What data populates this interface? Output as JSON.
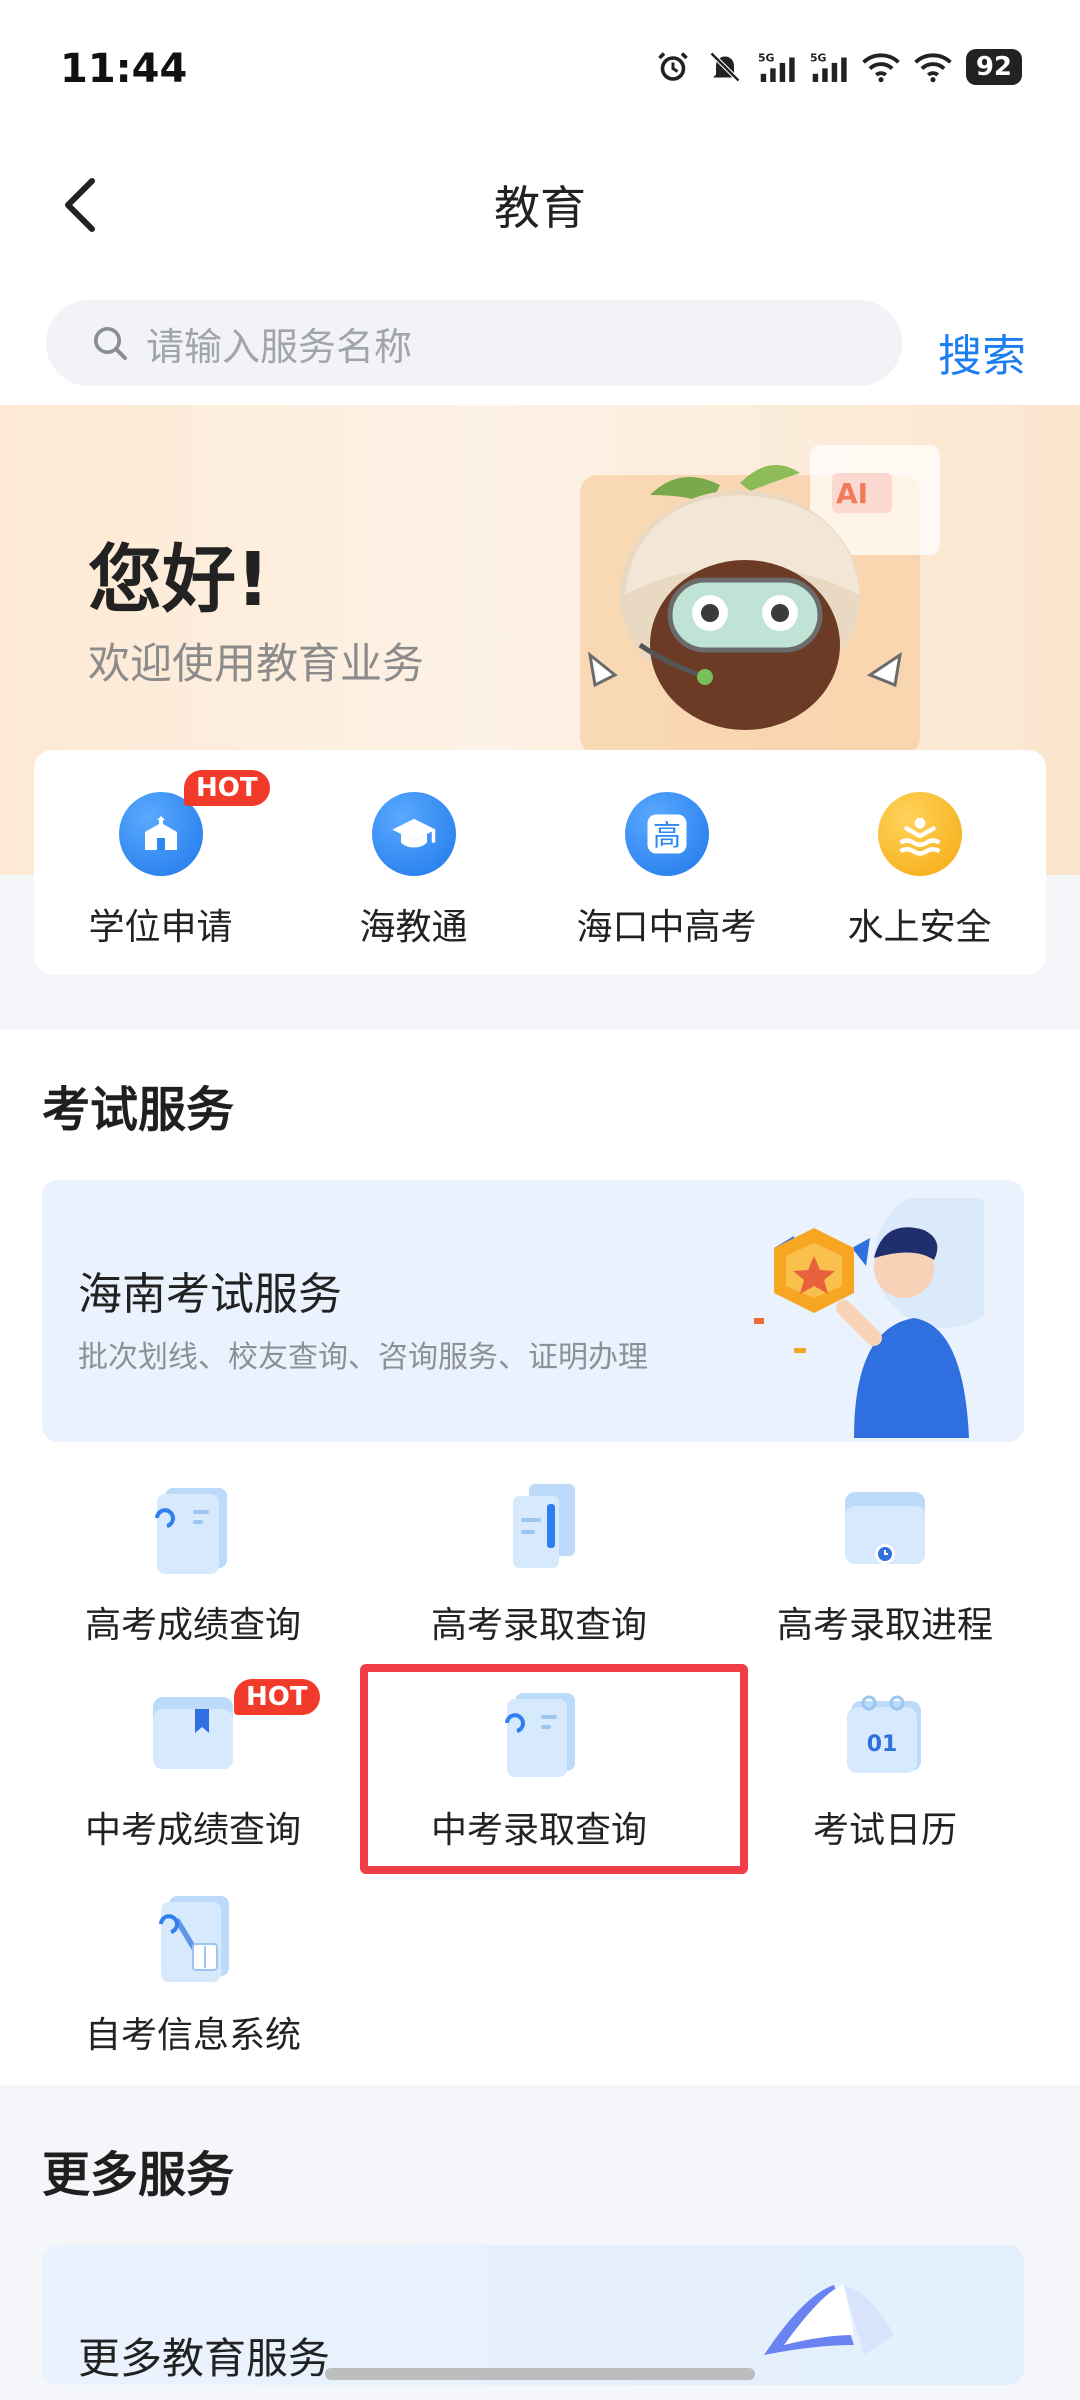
{
  "status": {
    "time": "11:44",
    "battery": "92",
    "icons": [
      "alarm-icon",
      "mute-icon",
      "signal-5g-icon",
      "signal-5g-icon",
      "wifi-icon",
      "wifi-icon"
    ]
  },
  "nav": {
    "title": "教育"
  },
  "search": {
    "placeholder": "请输入服务名称",
    "button_label": "搜索"
  },
  "hero": {
    "greeting": "您好!",
    "subtitle": "欢迎使用教育业务"
  },
  "quick_access": [
    {
      "label": "学位申请",
      "icon": "school-building-icon",
      "badge": "HOT",
      "color": "#2b8af0"
    },
    {
      "label": "海教通",
      "icon": "graduation-cap-icon",
      "color": "#2b8af0"
    },
    {
      "label": "海口中高考",
      "icon": "gao-character-icon",
      "icon_text": "高",
      "color": "#2b8af0"
    },
    {
      "label": "水上安全",
      "icon": "water-safety-icon",
      "color": "#f5b31c"
    }
  ],
  "exam_services": {
    "title": "考试服务",
    "banner": {
      "title": "海南考试服务",
      "subtitle": "批次划线、校友查询、咨询服务、证明办理"
    },
    "items": [
      {
        "label": "高考成绩查询",
        "icon": "document-clip-icon"
      },
      {
        "label": "高考录取查询",
        "icon": "document-stack-icon"
      },
      {
        "label": "高考录取进程",
        "icon": "folder-clock-icon"
      },
      {
        "label": "中考成绩查询",
        "icon": "folder-bookmark-icon",
        "badge": "HOT"
      },
      {
        "label": "中考录取查询",
        "icon": "document-clip-icon",
        "highlighted": true
      },
      {
        "label": "考试日历",
        "icon": "calendar-icon",
        "icon_text": "01"
      },
      {
        "label": "自考信息系统",
        "icon": "book-pen-icon"
      }
    ]
  },
  "more_services": {
    "title": "更多服务",
    "banner_title": "更多教育服务"
  },
  "colors": {
    "accent": "#1d7df2",
    "hot": "#f23a2b",
    "highlight_border": "#ef3e47"
  }
}
